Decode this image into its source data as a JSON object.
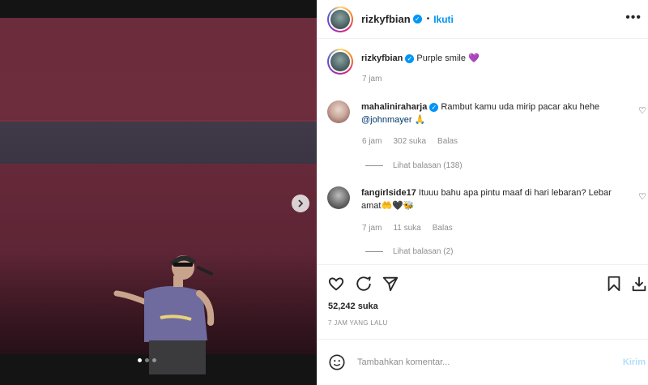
{
  "post": {
    "username": "rizkyfbian",
    "follow_label": "Ikuti",
    "dot_separator": "•",
    "more_label": "•••",
    "caption_user": "rizkyfbian",
    "caption_text": "Purple smile 💜",
    "caption_time": "7 jam"
  },
  "comments": [
    {
      "user": "mahaliniraharja",
      "text": "Rambut kamu uda mirip pacar aku hehe ",
      "mention": "@johnmayer",
      "emoji": " 🙏",
      "time": "6 jam",
      "likes": "302 suka",
      "reply": "Balas",
      "view_replies": "Lihat balasan (138)"
    },
    {
      "user": "fangirlside17",
      "text": "Ituuu bahu apa pintu maaf di hari lebaran? Lebar amat🤲🖤🐝",
      "time": "7 jam",
      "likes": "11 suka",
      "reply": "Balas",
      "view_replies": "Lihat balasan (2)"
    }
  ],
  "footer": {
    "likes": "52,242 suka",
    "time": "7 JAM YANG LALU",
    "placeholder": "Tambahkan komentar...",
    "send_label": "Kirim"
  },
  "carousel": {
    "slides": 3,
    "active_index": 0
  },
  "colors": {
    "accent": "#0095f6",
    "verified": "#0095f6",
    "muted": "#8e8e8e"
  },
  "icons": [
    "verified-badge-icon",
    "more-options-icon",
    "heart-icon",
    "comment-icon",
    "share-icon",
    "bookmark-icon",
    "download-icon",
    "emoji-icon",
    "chevron-right-icon"
  ]
}
